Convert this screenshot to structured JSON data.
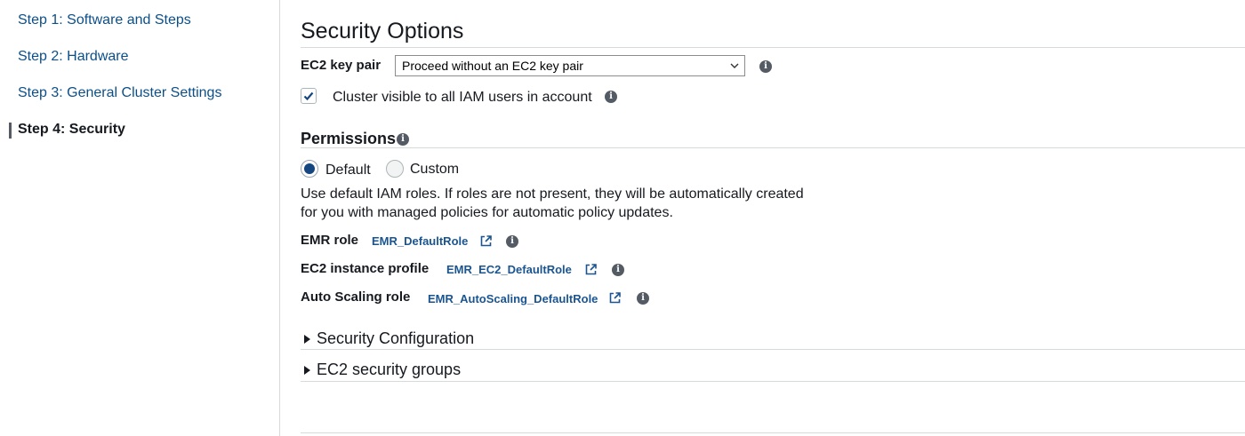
{
  "sidebar": {
    "steps": [
      {
        "label": "Step 1: Software and Steps"
      },
      {
        "label": "Step 2: Hardware"
      },
      {
        "label": "Step 3: General Cluster Settings"
      },
      {
        "label": "Step 4: Security"
      }
    ]
  },
  "security": {
    "title": "Security Options",
    "key_pair_label": "EC2 key pair",
    "key_pair_value": "Proceed without an EC2 key pair",
    "visibility_label": "Cluster visible to all IAM users in account",
    "visibility_checked": true
  },
  "permissions": {
    "title": "Permissions",
    "options": [
      {
        "label": "Default",
        "selected": true
      },
      {
        "label": "Custom",
        "selected": false
      }
    ],
    "description_line1": "Use default IAM roles. If roles are not present, they will be automatically created",
    "description_line2": "for you with managed policies for automatic policy updates.",
    "roles": [
      {
        "label": "EMR role",
        "value": "EMR_DefaultRole"
      },
      {
        "label": "EC2 instance profile",
        "value": "EMR_EC2_DefaultRole"
      },
      {
        "label": "Auto Scaling role",
        "value": "EMR_AutoScaling_DefaultRole"
      }
    ]
  },
  "sections": [
    {
      "label": "Security Configuration"
    },
    {
      "label": "EC2 security groups"
    }
  ],
  "colors": {
    "link": "#0b4f8a",
    "radio_selected": "#16467f",
    "info_icon": "#545b64"
  }
}
